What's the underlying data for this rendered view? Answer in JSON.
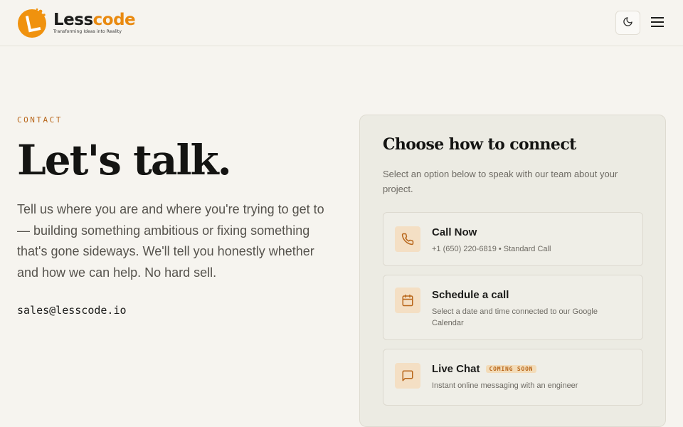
{
  "header": {
    "logo_name_part1": "Less",
    "logo_name_part2": "code",
    "logo_tagline": "Transforming Ideas into Reality",
    "theme_toggle_icon": "moon-icon",
    "menu_icon": "hamburger-menu-icon"
  },
  "hero": {
    "eyebrow": "CONTACT",
    "headline": "Let's talk.",
    "intro": "Tell us where you are and where you're trying to get to — building something ambitious or fixing something that's gone sideways. We'll tell you honestly whether and how we can help. No hard sell.",
    "email": "sales@lesscode.io"
  },
  "panel": {
    "title": "Choose how to connect",
    "subtitle": "Select an option below to speak with our team about your project.",
    "options": [
      {
        "icon": "phone-icon",
        "title": "Call Now",
        "description": "+1 (650) 220-6819 • Standard Call"
      },
      {
        "icon": "calendar-icon",
        "title": "Schedule a call",
        "description": "Select a date and time connected to our Google Calendar"
      },
      {
        "icon": "chat-icon",
        "title": "Live Chat",
        "badge": "COMING SOON",
        "description": "Instant online messaging with an engineer"
      }
    ]
  },
  "colors": {
    "accent": "#e98a10",
    "eyebrow": "#b8661a",
    "background": "#f6f4ef",
    "panel": "#ecebe3"
  }
}
